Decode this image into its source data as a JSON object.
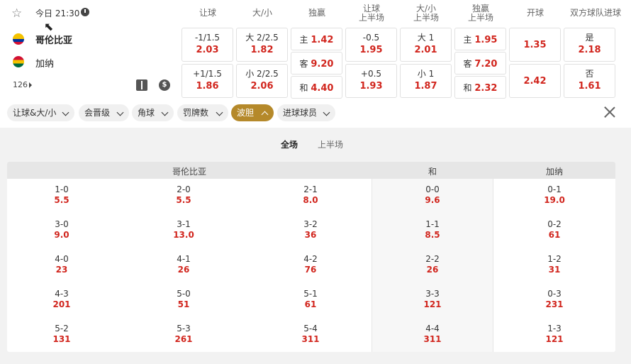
{
  "match": {
    "time": "今日 21:30",
    "home": "哥伦比亚",
    "away": "加纳",
    "market_count": "126"
  },
  "headers": {
    "handicap": "让球",
    "over_under": "大/小",
    "moneyline": "独赢",
    "handicap_half_1": "让球",
    "handicap_half_2": "上半场",
    "ou_half_1": "大/小",
    "ou_half_2": "上半场",
    "ml_half_1": "独赢",
    "ml_half_2": "上半场",
    "first_goal": "开球",
    "btts": "双方球队进球"
  },
  "odds": {
    "handicap": [
      {
        "line": "-1/1.5",
        "value": "2.03"
      },
      {
        "line": "+1/1.5",
        "value": "1.86"
      }
    ],
    "over_under": [
      {
        "line": "大 2/2.5",
        "value": "1.82"
      },
      {
        "line": "小 2/2.5",
        "value": "2.06"
      }
    ],
    "moneyline": [
      {
        "label": "主",
        "value": "1.42"
      },
      {
        "label": "客",
        "value": "9.20"
      },
      {
        "label": "和",
        "value": "4.40"
      }
    ],
    "handicap_half": [
      {
        "line": "-0.5",
        "value": "1.95"
      },
      {
        "line": "+0.5",
        "value": "1.93"
      }
    ],
    "ou_half": [
      {
        "line": "大 1",
        "value": "2.01"
      },
      {
        "line": "小 1",
        "value": "1.87"
      }
    ],
    "ml_half": [
      {
        "label": "主",
        "value": "1.95"
      },
      {
        "label": "客",
        "value": "7.20"
      },
      {
        "label": "和",
        "value": "2.32"
      }
    ],
    "first_goal": [
      "1.35",
      "2.42"
    ],
    "btts": [
      {
        "label": "是",
        "value": "2.18"
      },
      {
        "label": "否",
        "value": "1.61"
      }
    ]
  },
  "filters": [
    "让球&大/小",
    "会晋级",
    "角球",
    "罚牌数",
    "波胆",
    "进球球员"
  ],
  "active_filter": "波胆",
  "periods": [
    "全场",
    "上半场"
  ],
  "correct_score": {
    "headers": {
      "home": "哥伦比亚",
      "draw": "和",
      "away": "加纳"
    },
    "home": [
      [
        {
          "s": "1-0",
          "o": "5.5"
        },
        {
          "s": "2-0",
          "o": "5.5"
        },
        {
          "s": "2-1",
          "o": "8.0"
        }
      ],
      [
        {
          "s": "3-0",
          "o": "9.0"
        },
        {
          "s": "3-1",
          "o": "13.0"
        },
        {
          "s": "3-2",
          "o": "36"
        }
      ],
      [
        {
          "s": "4-0",
          "o": "23"
        },
        {
          "s": "4-1",
          "o": "26"
        },
        {
          "s": "4-2",
          "o": "76"
        }
      ],
      [
        {
          "s": "4-3",
          "o": "201"
        },
        {
          "s": "5-0",
          "o": "51"
        },
        {
          "s": "5-1",
          "o": "61"
        }
      ],
      [
        {
          "s": "5-2",
          "o": "131"
        },
        {
          "s": "5-3",
          "o": "261"
        },
        {
          "s": "5-4",
          "o": "311"
        }
      ]
    ],
    "draw": [
      {
        "s": "0-0",
        "o": "9.6"
      },
      {
        "s": "1-1",
        "o": "8.5"
      },
      {
        "s": "2-2",
        "o": "26"
      },
      {
        "s": "3-3",
        "o": "121"
      },
      {
        "s": "4-4",
        "o": "311"
      }
    ],
    "away": [
      {
        "s": "0-1",
        "o": "19.0"
      },
      {
        "s": "0-2",
        "o": "61"
      },
      {
        "s": "1-2",
        "o": "31"
      },
      {
        "s": "0-3",
        "o": "231"
      },
      {
        "s": "1-3",
        "o": "121"
      }
    ]
  },
  "icons": {
    "favorite": "star-icon",
    "clock": "clock-icon",
    "pitch": "pitch-icon",
    "money": "dollar-icon",
    "close": "close-icon"
  },
  "colors": {
    "odds": "#d1251d",
    "active_chip": "#b5892a"
  }
}
